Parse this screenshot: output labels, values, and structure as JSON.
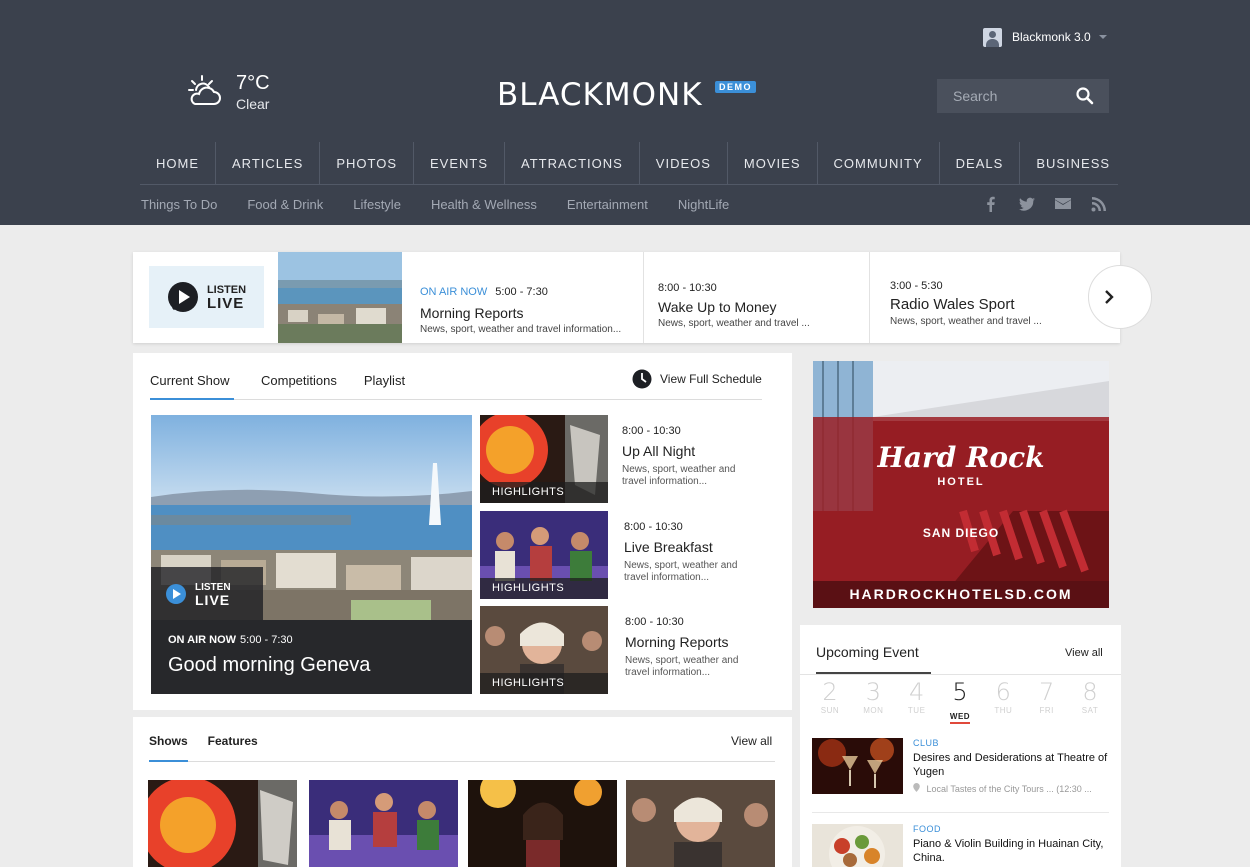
{
  "header": {
    "user_name": "Blackmonk 3.0",
    "weather": {
      "temp": "7°C",
      "condition": "Clear"
    },
    "logo": "BLACKMONK",
    "badge": "DEMO",
    "search_placeholder": "Search",
    "nav": [
      "HOME",
      "ARTICLES",
      "PHOTOS",
      "EVENTS",
      "ATTRACTIONS",
      "VIDEOS",
      "MOVIES",
      "COMMUNITY",
      "DEALS",
      "BUSINESS"
    ],
    "subnav": [
      "Things To Do",
      "Food & Drink",
      "Lifestyle",
      "Health & Wellness",
      "Entertainment",
      "NightLife"
    ],
    "social_icons": [
      "facebook-icon",
      "twitter-icon",
      "mail-icon",
      "rss-icon"
    ]
  },
  "strip": {
    "listen": "LISTEN",
    "live": "LIVE",
    "items": [
      {
        "onair": "ON AIR NOW",
        "time": "5:00 - 7:30",
        "title": "Morning Reports",
        "desc": "News, sport, weather and travel information..."
      },
      {
        "time": "8:00 - 10:30",
        "title": "Wake Up to Money",
        "desc": "News, sport, weather and travel ..."
      },
      {
        "time": "3:00 - 5:30",
        "title": "Radio Wales Sport",
        "desc": "News, sport, weather and travel ..."
      }
    ]
  },
  "current_show": {
    "tabs": [
      "Current Show",
      "Competitions",
      "Playlist"
    ],
    "schedule_link": "View Full Schedule",
    "featured": {
      "listen": "LISTEN",
      "live": "LIVE",
      "onair": "ON AIR NOW",
      "time": "5:00 - 7:30",
      "title": "Good morning Geneva"
    },
    "programs": [
      {
        "badge": "HIGHLIGHTS",
        "time": "8:00 - 10:30",
        "title": "Up All Night",
        "desc": "News, sport, weather and travel information..."
      },
      {
        "badge": "HIGHLIGHTS",
        "time": "8:00 - 10:30",
        "title": "Live Breakfast",
        "desc": "News, sport, weather and travel information..."
      },
      {
        "badge": "HIGHLIGHTS",
        "time": "8:00 - 10:30",
        "title": "Morning Reports",
        "desc": "News, sport, weather and travel information..."
      }
    ]
  },
  "shows": {
    "tabs": [
      "Shows",
      "Features"
    ],
    "view_all": "View all"
  },
  "ad": {
    "brand": "Hard Rock",
    "sub": "HOTEL",
    "city": "SAN DIEGO",
    "url": "HARDROCKHOTELSD.COM"
  },
  "events": {
    "title": "Upcoming Event",
    "view_all": "View all",
    "days": [
      {
        "num": "2",
        "name": "SUN"
      },
      {
        "num": "3",
        "name": "MON"
      },
      {
        "num": "4",
        "name": "TUE"
      },
      {
        "num": "5",
        "name": "WED"
      },
      {
        "num": "6",
        "name": "THU"
      },
      {
        "num": "7",
        "name": "FRI"
      },
      {
        "num": "8",
        "name": "SAT"
      }
    ],
    "items": [
      {
        "category": "CLUB",
        "title": "Desires and Desiderations at Theatre of Yugen",
        "location": "Local Tastes of the City Tours ... (12:30 ..."
      },
      {
        "category": "FOOD",
        "title": "Piano & Violin Building in Huainan City, China.",
        "location": ""
      }
    ]
  }
}
